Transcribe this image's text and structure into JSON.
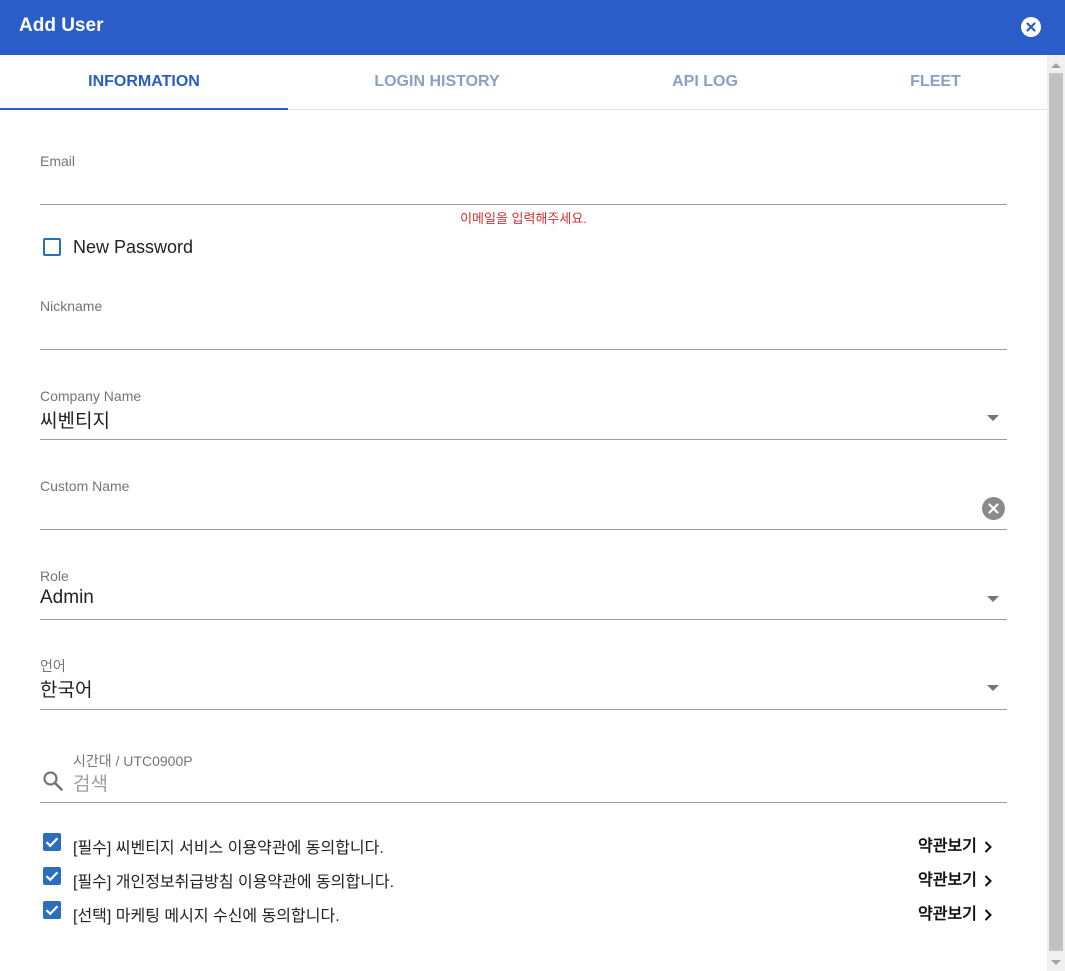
{
  "dialog": {
    "title": "Add User"
  },
  "tabs": [
    {
      "label": "INFORMATION",
      "active": true
    },
    {
      "label": "LOGIN HISTORY",
      "active": false
    },
    {
      "label": "API LOG",
      "active": false
    },
    {
      "label": "FLEET",
      "active": false
    }
  ],
  "form": {
    "email": {
      "label": "Email",
      "value": "",
      "error": "이메일을 입력해주세요."
    },
    "new_password": {
      "label": "New Password",
      "checked": false
    },
    "nickname": {
      "label": "Nickname",
      "value": ""
    },
    "company_name": {
      "label": "Company Name",
      "value": "씨벤티지"
    },
    "custom_name": {
      "label": "Custom Name",
      "value": ""
    },
    "role": {
      "label": "Role",
      "value": "Admin"
    },
    "language": {
      "label": "언어",
      "value": "한국어"
    },
    "timezone": {
      "label": "시간대 / UTC0900P",
      "placeholder": "검색"
    }
  },
  "agreements": [
    {
      "text": "[필수] 씨벤티지 서비스 이용약관에 동의합니다.",
      "checked": true,
      "link": "약관보기"
    },
    {
      "text": "[필수] 개인정보취급방침 이용약관에 동의합니다.",
      "checked": true,
      "link": "약관보기"
    },
    {
      "text": "[선택] 마케팅 메시지 수신에 동의합니다.",
      "checked": true,
      "link": "약관보기"
    }
  ],
  "colors": {
    "primary": "#2a5dc8",
    "error": "#d32f2f",
    "checkbox": "#2a6ebd"
  }
}
